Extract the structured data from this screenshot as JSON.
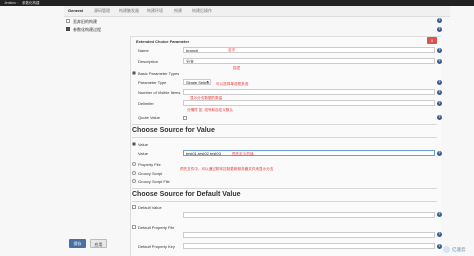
{
  "breadcrumb": {
    "root": "Jenkins",
    "job": "参数化构建"
  },
  "tabs": [
    "General",
    "源码管理",
    "构建触发器",
    "构建环境",
    "构建",
    "构建后操作"
  ],
  "general": {
    "discard_builds": "丢弃旧的构建",
    "parameterized": "参数化构建过程"
  },
  "panel": {
    "title": "Extended Choice Parameter",
    "delete_glyph": "X",
    "name_label": "Name",
    "name_value": "branch",
    "description_label": "Description",
    "description_value": "分支",
    "basic_param_types": "Basic Parameter Types",
    "parameter_type_label": "Parameter Type",
    "parameter_type_value": "Single Select",
    "visible_items_label": "Number of Visible Items",
    "delimiter_label": "Delimiter",
    "quote_value_label": "Quote Value",
    "choose_source_title": "Choose Source for Value",
    "value_radio_label": "Value",
    "value_label": "Value",
    "value_value": "test01,test02,test03",
    "property_file_label": "Property File",
    "groovy_script_label": "Groovy Script",
    "groovy_script_file_label": "Groovy Script File",
    "choose_default_title": "Choose Source for Default Value",
    "default_value_label": "Default Value",
    "default_property_file_label": "Default Property File",
    "default_property_key_label": "Default Property Key"
  },
  "annotations": {
    "name": "名字",
    "description": "描述",
    "parameter_type": "可以选择单选框多选",
    "visible_items": "显示分支数据的数量",
    "delimiter": "分隔符 如 ,逗号和自定义默认",
    "value": "预先定义的值",
    "property_file": "预先文件中，可以通过脚本控制更新服务器文件来显示分支"
  },
  "buttons": {
    "save": "保存",
    "apply": "应用"
  },
  "watermark": "亿速云",
  "help_glyph": "?"
}
